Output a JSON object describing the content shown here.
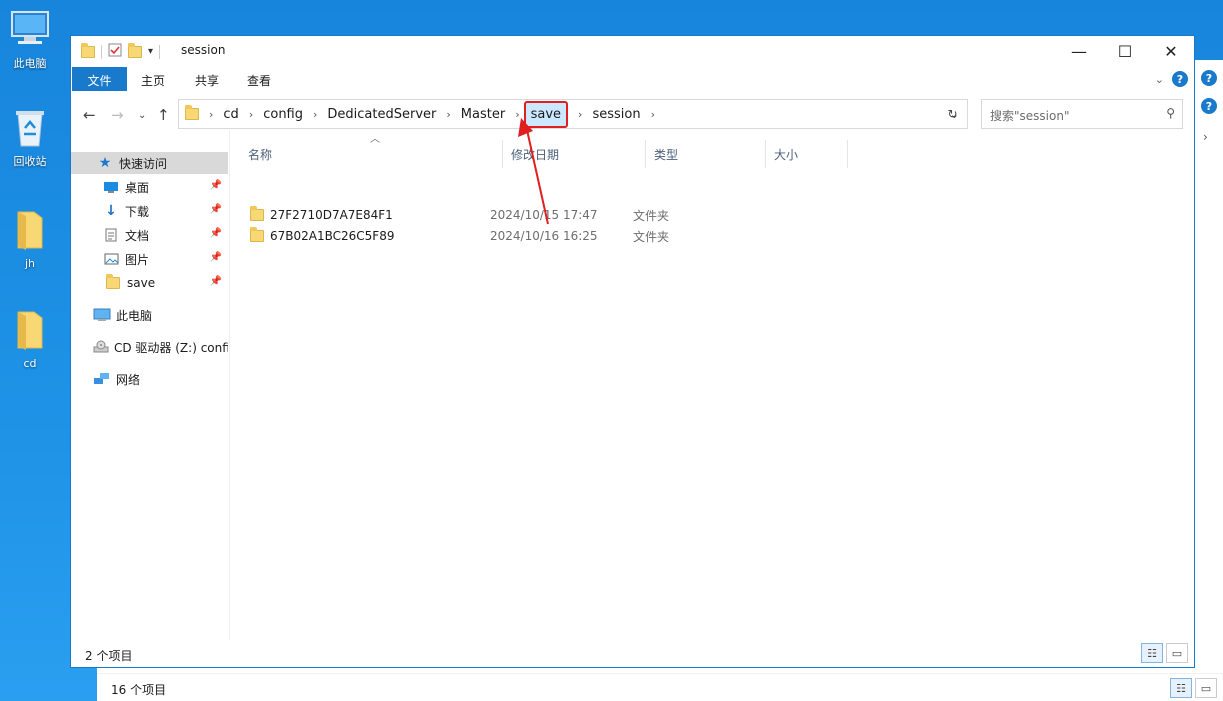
{
  "desktop": {
    "icons": [
      {
        "label": "此电脑",
        "icon": "computer-icon"
      },
      {
        "label": "回收站",
        "icon": "recycle-bin-icon"
      },
      {
        "label": "jh",
        "icon": "folder-icon"
      },
      {
        "label": "cd",
        "icon": "folder-icon"
      }
    ]
  },
  "background_window": {
    "status_text": "16 个项目"
  },
  "window": {
    "title": "session",
    "controls": {
      "minimize": "—",
      "maximize": "☐",
      "close": "✕"
    },
    "ribbon": {
      "tabs": [
        "文件",
        "主页",
        "共享",
        "查看"
      ]
    },
    "address": {
      "crumbs": [
        "cd",
        "config",
        "DedicatedServer",
        "Master",
        "save",
        "session"
      ],
      "highlighted": "save",
      "highlight_color": "#e02020"
    },
    "search": {
      "placeholder": "搜索\"session\""
    },
    "sidebar": {
      "quick_access": "快速访问",
      "pinned": [
        {
          "label": "桌面",
          "icon": "desktop-icon"
        },
        {
          "label": "下载",
          "icon": "download-icon"
        },
        {
          "label": "文档",
          "icon": "document-icon"
        },
        {
          "label": "图片",
          "icon": "pictures-icon"
        },
        {
          "label": "save",
          "icon": "folder-icon"
        }
      ],
      "this_pc": "此电脑",
      "cd_drive": "CD 驱动器 (Z:) confi",
      "network": "网络"
    },
    "columns": [
      "名称",
      "修改日期",
      "类型",
      "大小"
    ],
    "files": [
      {
        "name": "27F2710D7A7E84F1",
        "date": "2024/10/15 17:47",
        "type": "文件夹"
      },
      {
        "name": "67B02A1BC26C5F89",
        "date": "2024/10/16 16:25",
        "type": "文件夹"
      }
    ],
    "status_text": "2 个项目"
  },
  "colors": {
    "accent": "#1979ca",
    "annotation": "#e02020",
    "folder": "#f8d775"
  }
}
